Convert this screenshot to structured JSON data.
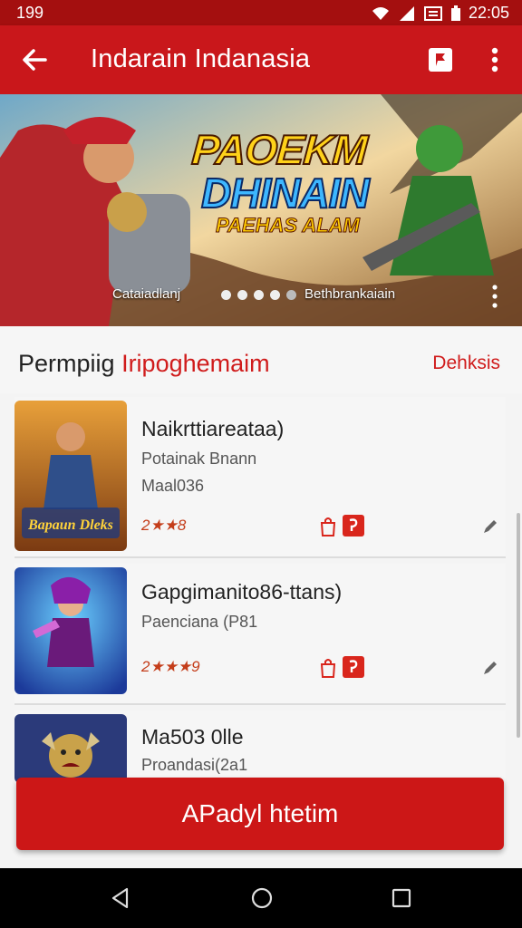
{
  "status": {
    "time_left": "199",
    "time_right": "22:05"
  },
  "appbar": {
    "title": "Indarain Indanasia"
  },
  "banner": {
    "logo_line1": "PAOEKM",
    "logo_line2": "DHINAIN",
    "logo_line3": "PAEHAS ALAM",
    "left_caption": "Cataiadlanj",
    "right_caption": "Bethbrankaiain"
  },
  "section": {
    "title_black": "Permpiig",
    "title_red": "Iripoghemaim",
    "link": "Dehksis"
  },
  "games": [
    {
      "name": "Naikrttiareataa)",
      "sub1": "Potainak Bnann",
      "sub2": "Maal036",
      "rating": "2★★8",
      "art_text": "Bapaun Dleks",
      "colors": [
        "#e8a03a",
        "#7b3a12"
      ]
    },
    {
      "name": "Gapgimanito86-ttans)",
      "sub1": "Paenciana (P81",
      "sub2": "",
      "rating": "2★★★9",
      "art_text": "",
      "colors": [
        "#2a6fe0",
        "#5a1d8a"
      ]
    },
    {
      "name": "Ma503 0lle",
      "sub1": "Proandasi(2a1",
      "sub2": "",
      "rating": "",
      "art_text": "",
      "colors": [
        "#2b3a7a",
        "#c9a24a"
      ]
    }
  ],
  "cta": {
    "label": "APadyl htetim"
  },
  "colors": {
    "primary": "#c9171b",
    "accent": "#d01c1c"
  }
}
